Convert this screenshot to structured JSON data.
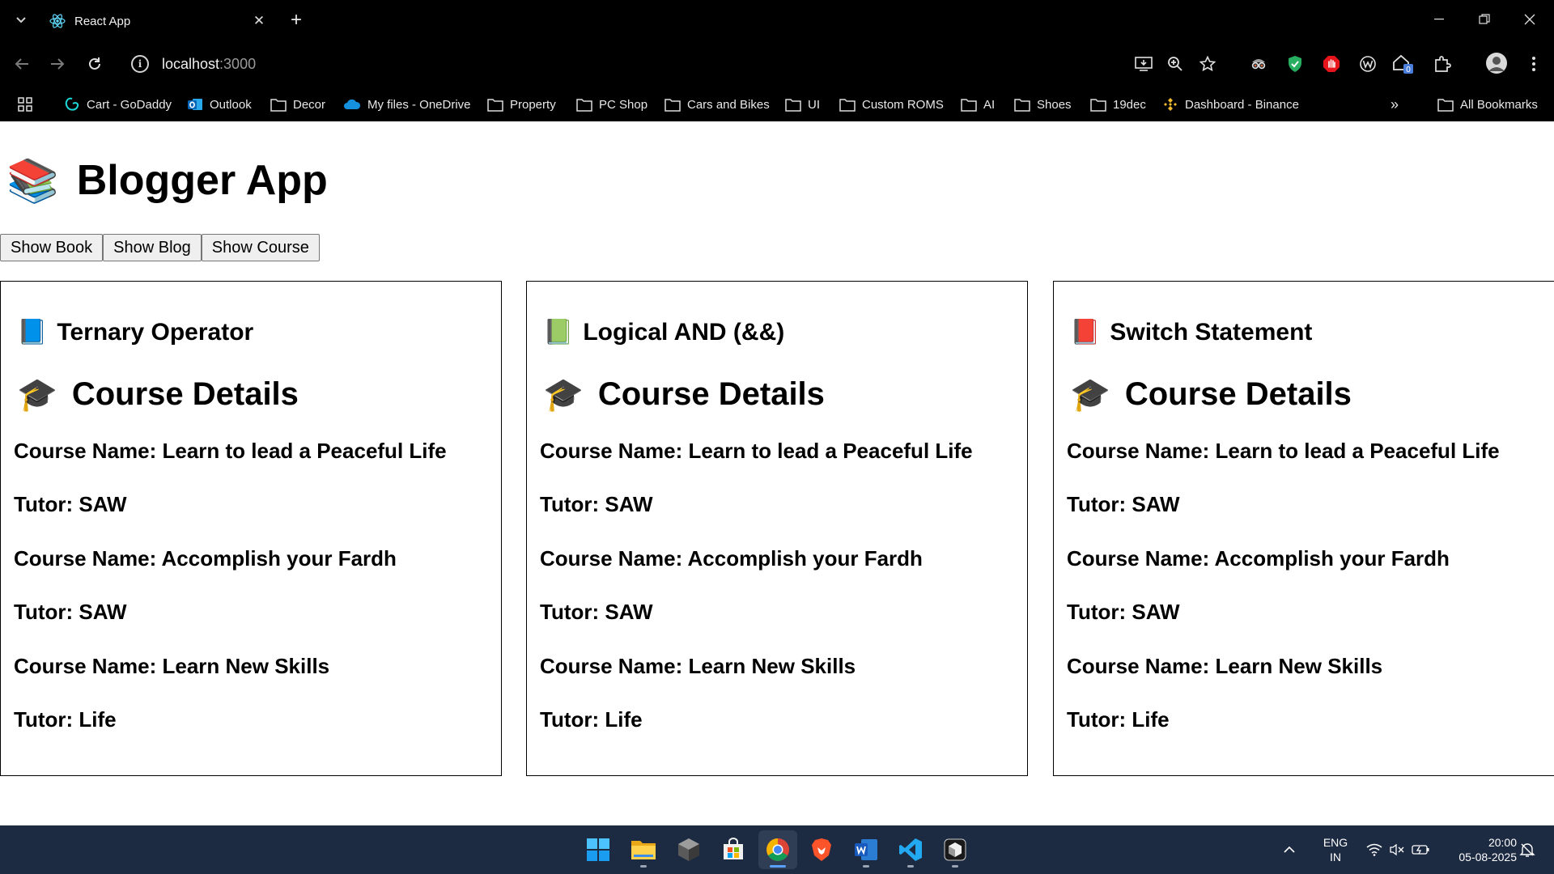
{
  "browser": {
    "tab_title": "React App",
    "url_host": "localhost",
    "url_port": ":3000",
    "extension_badge": "0"
  },
  "bookmarks": [
    {
      "label": "Cart - GoDaddy",
      "icon": "godaddy-icon"
    },
    {
      "label": "Outlook",
      "icon": "outlook-icon"
    },
    {
      "label": "Decor",
      "icon": "folder-icon"
    },
    {
      "label": "My files - OneDrive",
      "icon": "onedrive-icon"
    },
    {
      "label": "Property",
      "icon": "folder-icon"
    },
    {
      "label": "PC Shop",
      "icon": "folder-icon"
    },
    {
      "label": "Cars and Bikes",
      "icon": "folder-icon"
    },
    {
      "label": "UI",
      "icon": "folder-icon"
    },
    {
      "label": "Custom ROMS",
      "icon": "folder-icon"
    },
    {
      "label": "AI",
      "icon": "folder-icon"
    },
    {
      "label": "Shoes",
      "icon": "folder-icon"
    },
    {
      "label": "19dec",
      "icon": "folder-icon"
    },
    {
      "label": "Dashboard - Binance",
      "icon": "binance-icon"
    }
  ],
  "all_bookmarks": "All Bookmarks",
  "page": {
    "title_emoji": "📚",
    "title": "Blogger App",
    "buttons": [
      "Show Book",
      "Show Blog",
      "Show Course"
    ],
    "cards": [
      {
        "heading_emoji": "📘",
        "heading": "Ternary Operator",
        "section_emoji": "🎓",
        "section": "Course Details",
        "lines": [
          "Course Name: Learn to lead a Peaceful Life",
          "Tutor: SAW",
          "Course Name: Accomplish your Fardh",
          "Tutor: SAW",
          "Course Name: Learn New Skills",
          "Tutor: Life"
        ]
      },
      {
        "heading_emoji": "📗",
        "heading": "Logical AND (&&)",
        "section_emoji": "🎓",
        "section": "Course Details",
        "lines": [
          "Course Name: Learn to lead a Peaceful Life",
          "Tutor: SAW",
          "Course Name: Accomplish your Fardh",
          "Tutor: SAW",
          "Course Name: Learn New Skills",
          "Tutor: Life"
        ]
      },
      {
        "heading_emoji": "📕",
        "heading": "Switch Statement",
        "section_emoji": "🎓",
        "section": "Course Details",
        "lines": [
          "Course Name: Learn to lead a Peaceful Life",
          "Tutor: SAW",
          "Course Name: Accomplish your Fardh",
          "Tutor: SAW",
          "Course Name: Learn New Skills",
          "Tutor: Life"
        ]
      }
    ]
  },
  "taskbar": {
    "lang_1": "ENG",
    "lang_2": "IN",
    "time": "20:00",
    "date": "05-08-2025"
  },
  "colors": {
    "browser_bg": "#000000",
    "page_bg": "#ffffff",
    "taskbar_bg": "#1c2a42",
    "accent": "#5aa0ff"
  }
}
